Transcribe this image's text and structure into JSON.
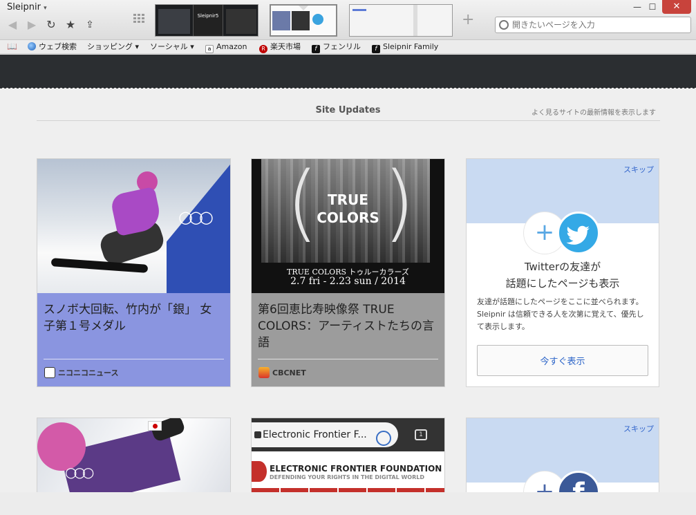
{
  "window": {
    "title": "Sleipnir",
    "title_caret": "▾",
    "minimize": "—",
    "maximize": "☐",
    "close": "✕"
  },
  "toolbar": {
    "address_placeholder": "開きたいページを入力",
    "new_tab": "+",
    "thumb1_caption": "Sleipnir5"
  },
  "bookmarks": [
    {
      "label": "ウェブ検索",
      "icon": "globe-icon"
    },
    {
      "label": "ショッピング ▾",
      "icon": ""
    },
    {
      "label": "ソーシャル ▾",
      "icon": ""
    },
    {
      "label": "Amazon",
      "icon": "amazon-icon",
      "glyph": "a"
    },
    {
      "label": "楽天市場",
      "icon": "rakuten-icon",
      "glyph": "R"
    },
    {
      "label": "フェンリル",
      "icon": "fenrir-icon",
      "glyph": "f"
    },
    {
      "label": "Sleipnir Family",
      "icon": "fenrir-icon",
      "glyph": "f"
    }
  ],
  "site_updates": {
    "title": "Site Updates",
    "subtitle": "よく見るサイトの最新情報を表示します"
  },
  "cards": [
    {
      "title": "スノボ大回転、竹内が「銀」 女子第１号メダル",
      "source": "ニコニコニュース",
      "bg": "#8a95e0"
    },
    {
      "title": "第6回恵比寿映像祭 TRUE COLORS：アーティストたちの言語",
      "source": "CBCNET",
      "bg": "#9c9c9c",
      "image_text": {
        "word1": "TRUE",
        "word2": "COLORS",
        "line1": "TRUE COLORS トゥルーカラーズ",
        "line2": "2.7 fri - 2.23 sun / 2014"
      }
    }
  ],
  "twitter_card": {
    "skip": "スキップ",
    "title_line1": "Twitterの友達が",
    "title_line2": "話題にしたページも表示",
    "description": "友達が話題にしたページをここに並べられます。Sleipnir は信頼できる人を次第に覚えて、優先して表示します。",
    "button": "今すぐ表示"
  },
  "eff_card": {
    "tab_title": "Electronic Frontier F...",
    "tab_count": "1",
    "heading": "ELECTRONIC FRONTIER FOUNDATION",
    "tagline": "DEFENDING YOUR RIGHTS IN THE DIGITAL WORLD"
  },
  "facebook_card": {
    "skip": "スキップ",
    "glyph": "f"
  },
  "colors": {
    "dark_band": "#2b2e31",
    "card1": "#8a95e0",
    "card2": "#9c9c9c",
    "twitter_header": "#c9daf2",
    "close_button": "#c8433c"
  }
}
